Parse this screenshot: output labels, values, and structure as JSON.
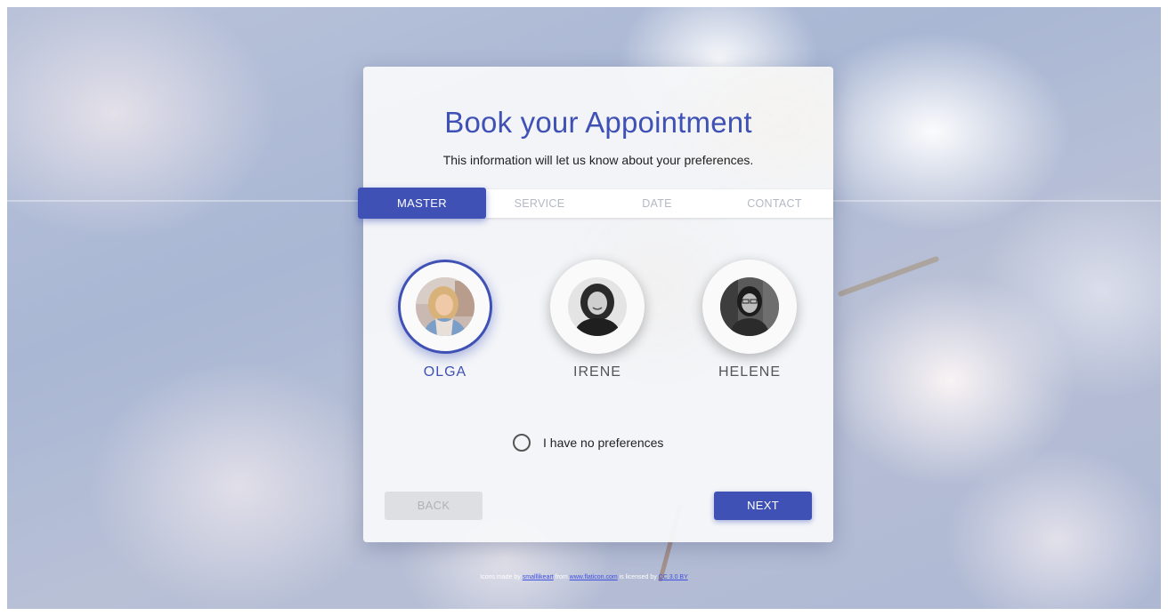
{
  "page": {
    "title": "Book your Appointment",
    "subtitle": "This information will let us know about your preferences."
  },
  "tabs": [
    {
      "label": "MASTER",
      "active": true
    },
    {
      "label": "SERVICE",
      "active": false
    },
    {
      "label": "DATE",
      "active": false
    },
    {
      "label": "CONTACT",
      "active": false
    }
  ],
  "masters": [
    {
      "name": "OLGA",
      "selected": true,
      "icon": "avatar-photo"
    },
    {
      "name": "IRENE",
      "selected": false,
      "icon": "avatar-photo"
    },
    {
      "name": "HELENE",
      "selected": false,
      "icon": "avatar-photo"
    }
  ],
  "preference": {
    "label": "I have no preferences",
    "checked": false
  },
  "buttons": {
    "back_label": "BACK",
    "next_label": "NEXT"
  },
  "footer": {
    "prefix": "Icons made by",
    "author": "smalllikeart",
    "from_text": "from",
    "site": "www.flaticon.com",
    "licensed_text": "is licensed by",
    "license": "CC 3.0 BY"
  },
  "colors": {
    "accent": "#3f51b5",
    "disabled_bg": "#dedfe2",
    "disabled_text": "#b0b2b8",
    "tab_inactive_text": "#b4b8c4"
  }
}
